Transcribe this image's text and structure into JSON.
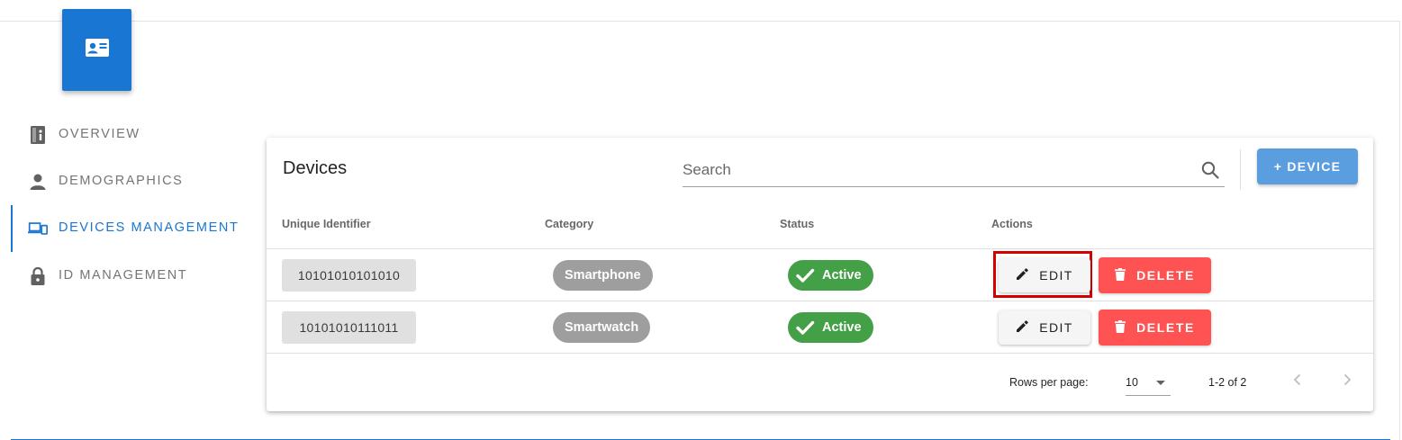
{
  "nav": {
    "items": [
      {
        "label": "OVERVIEW",
        "icon": "overview-info-icon"
      },
      {
        "label": "DEMOGRAPHICS",
        "icon": "person-icon"
      },
      {
        "label": "DEVICES MANAGEMENT",
        "icon": "devices-icon",
        "active": true
      },
      {
        "label": "ID MANAGEMENT",
        "icon": "lock-icon"
      }
    ]
  },
  "devices": {
    "title": "Devices",
    "search_placeholder": "Search",
    "add_button": "+ DEVICE",
    "columns": [
      "Unique Identifier",
      "Category",
      "Status",
      "Actions"
    ],
    "rows": [
      {
        "id": "10101010101010",
        "category": "Smartphone",
        "status": "Active",
        "edit": "EDIT",
        "delete": "DELETE"
      },
      {
        "id": "10101010111011",
        "category": "Smartwatch",
        "status": "Active",
        "edit": "EDIT",
        "delete": "DELETE"
      }
    ],
    "footer": {
      "rows_per_page_label": "Rows per page:",
      "rows_per_page_value": "10",
      "range": "1-2 of 2"
    }
  },
  "colors": {
    "primary": "#1976d2",
    "add_button": "#5b9ee0",
    "status_active": "#43a047",
    "delete": "#ff5252",
    "category_chip": "#9e9e9e",
    "highlight": "#d50000"
  }
}
